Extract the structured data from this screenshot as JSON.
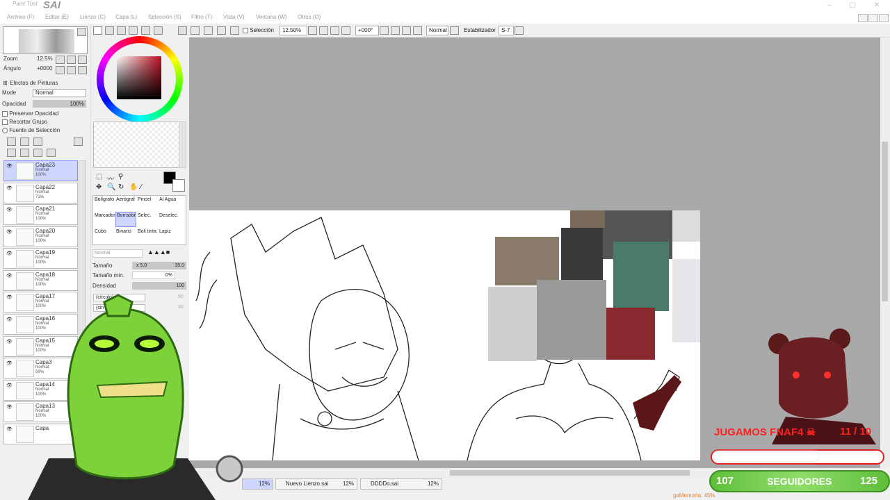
{
  "app": {
    "title_small": "Paint Tool",
    "title_big": "SAI"
  },
  "menu": [
    "Archivo (F)",
    "Editar (E)",
    "Lienzo (C)",
    "Capa (L)",
    "Selección (S)",
    "Filtro (T)",
    "Vista (V)",
    "Ventana (W)",
    "Otros (O)"
  ],
  "toolbar": {
    "selection_label": "Selección",
    "zoom": "12.50%",
    "angle": "+000°",
    "blend": "Normal",
    "stabilizer_label": "Estabilizador",
    "stabilizer_value": "S-7"
  },
  "navigator": {
    "zoom_label": "Zoom",
    "zoom_value": "12.5%",
    "angle_label": "Ángulo",
    "angle_value": "+0000"
  },
  "paint_effects": {
    "header": "Efectos de Pinturas",
    "mode_label": "Mode",
    "mode_value": "Normal",
    "opacity_label": "Opacidad",
    "opacity_value": "100%",
    "preserve": "Preservar Opacidad",
    "clip": "Recortar Grupo",
    "selection_source": "Fuente de Selección"
  },
  "layers": [
    {
      "name": "Capa23",
      "mode": "Normal",
      "opacity": "100%"
    },
    {
      "name": "Capa22",
      "mode": "Normal",
      "opacity": "71%"
    },
    {
      "name": "Capa21",
      "mode": "Normal",
      "opacity": "100%"
    },
    {
      "name": "Capa20",
      "mode": "Normal",
      "opacity": "100%"
    },
    {
      "name": "Capa19",
      "mode": "Normal",
      "opacity": "100%"
    },
    {
      "name": "Capa18",
      "mode": "Normal",
      "opacity": "100%"
    },
    {
      "name": "Capa17",
      "mode": "Normal",
      "opacity": "100%"
    },
    {
      "name": "Capa16",
      "mode": "Normal",
      "opacity": "100%"
    },
    {
      "name": "Capa15",
      "mode": "Normal",
      "opacity": "100%"
    },
    {
      "name": "Capa3",
      "mode": "Normal",
      "opacity": "59%"
    },
    {
      "name": "Capa14",
      "mode": "Normal",
      "opacity": "100%"
    },
    {
      "name": "Capa13",
      "mode": "Normal",
      "opacity": "100%"
    },
    {
      "name": "Capa",
      "mode": "",
      "opacity": ""
    }
  ],
  "tools": [
    [
      "Bolígrafo",
      "Aerógraf",
      "Pincel",
      "Al Agua"
    ],
    [
      "Marcador",
      "Borrador",
      "Selec.",
      "Deselec."
    ],
    [
      "Cubo",
      "Binario",
      "Boli tinta",
      "Lapiz"
    ]
  ],
  "brush": {
    "blend": "Normal",
    "size_label": "Tamaño",
    "size_mult": "x 5.0",
    "size_value": "35.0",
    "min_size_label": "Tamaño min.",
    "min_size_value": "0%",
    "density_label": "Densidad",
    "density_value": "100",
    "shape": "(círculo)",
    "texture": "(sin",
    "shape_val": "50",
    "tex_val": "95"
  },
  "tabs": [
    {
      "name": "",
      "pct": "12%"
    },
    {
      "name": "Nuevo Lienzo.sai",
      "pct": "12%"
    },
    {
      "name": "DDDDo.sai",
      "pct": "12%"
    }
  ],
  "overlay": {
    "title": "JUGAMOS FNAF4 ☠",
    "counter": "11 / 10",
    "followers_current": "107",
    "followers_label": "SEGUIDORES",
    "followers_goal": "125",
    "memory": "gaMemoria: 45%"
  },
  "colors": {
    "accent": "#ccd6ff",
    "goal": "#e02020",
    "followers": "#5fbf3a"
  }
}
